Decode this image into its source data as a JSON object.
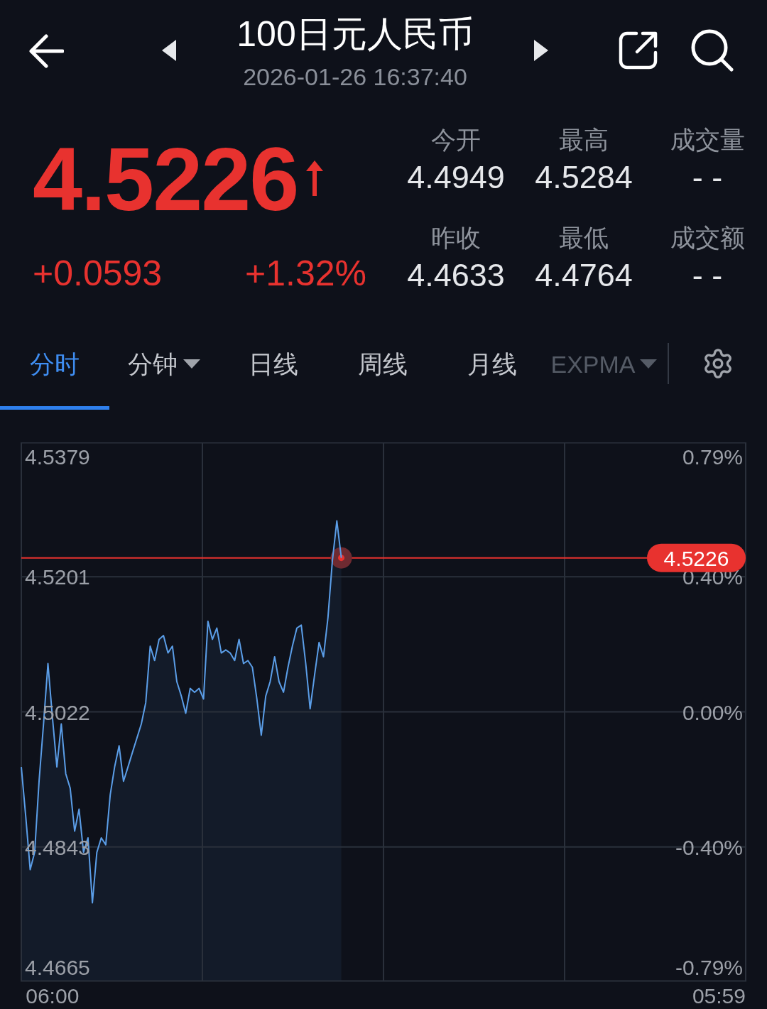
{
  "header": {
    "title": "100日元人民币",
    "timestamp": "2026-01-26 16:37:40"
  },
  "quote": {
    "price": "4.5226",
    "rising": true,
    "change": "+0.0593",
    "change_percent": "+1.32%"
  },
  "stats": [
    {
      "label": "今开",
      "value": "4.4949"
    },
    {
      "label": "最高",
      "value": "4.5284"
    },
    {
      "label": "成交量",
      "value": "- -"
    },
    {
      "label": "昨收",
      "value": "4.4633"
    },
    {
      "label": "最低",
      "value": "4.4764"
    },
    {
      "label": "成交额",
      "value": "- -"
    }
  ],
  "tabs": [
    {
      "label": "分时",
      "selected": true,
      "dropdown": false
    },
    {
      "label": "分钟",
      "selected": false,
      "dropdown": true
    },
    {
      "label": "日线",
      "selected": false,
      "dropdown": false
    },
    {
      "label": "周线",
      "selected": false,
      "dropdown": false
    },
    {
      "label": "月线",
      "selected": false,
      "dropdown": false
    }
  ],
  "indicator_selector": {
    "label": "EXPMA"
  },
  "chart": {
    "chart_data": {
      "type": "area",
      "grid": true,
      "categories": [
        null,
        null,
        null,
        null,
        null,
        null,
        null,
        "06:00",
        null,
        null,
        null,
        null,
        null,
        null,
        null,
        null,
        null,
        null,
        null,
        null,
        null,
        null,
        null,
        null,
        null,
        null,
        null,
        null,
        null,
        null,
        null,
        null,
        null,
        null,
        null,
        null,
        null,
        null,
        null,
        null,
        null,
        null,
        null,
        null,
        null,
        null,
        null,
        null,
        null,
        null,
        null,
        null,
        null,
        null,
        null,
        null,
        null,
        null,
        null,
        null,
        null,
        null,
        null,
        null,
        null,
        null,
        null,
        null,
        null,
        null,
        null,
        null,
        null,
        null,
        null,
        null,
        null,
        null,
        null,
        null,
        null,
        null,
        null,
        null,
        null,
        null,
        null,
        null,
        null,
        null,
        null,
        null,
        null,
        null,
        null,
        null,
        null,
        null,
        null,
        null,
        null,
        null,
        null,
        null,
        null,
        null,
        null,
        null,
        null,
        null,
        null,
        null,
        null,
        null,
        null,
        null,
        null,
        null,
        null,
        null,
        null,
        null,
        null,
        null,
        null,
        null,
        null,
        null,
        null,
        null,
        null,
        null,
        null,
        null,
        null,
        null,
        null,
        null,
        null,
        null,
        null,
        null,
        null,
        null,
        null,
        null,
        null,
        null,
        null,
        null,
        null,
        null,
        null,
        null,
        null,
        null,
        null,
        "05:59",
        null,
        null,
        null,
        null,
        null,
        null
      ],
      "series": [
        {
          "color": "#5b9ee8",
          "values": [
            4.4949,
            4.4883,
            4.4813,
            4.4836,
            4.493,
            4.5006,
            4.5086,
            4.5015,
            4.4949,
            4.5006,
            4.494,
            4.4921,
            4.4864,
            4.4893,
            4.4836,
            4.4855,
            4.4769,
            4.4836,
            4.4855,
            4.4846,
            4.4912,
            4.4949,
            4.4977,
            4.493,
            4.4949,
            4.4968,
            4.4987,
            4.5006,
            4.5034,
            4.5109,
            4.509,
            4.5118,
            4.5123,
            4.51,
            4.5109,
            4.5062,
            4.5043,
            4.502,
            4.5053,
            4.5048,
            4.5053,
            4.5039,
            4.5142,
            4.5118,
            4.5133,
            4.51,
            4.5104,
            4.51,
            4.509,
            4.5118,
            4.5086,
            4.509,
            4.5081,
            4.5039,
            4.4991,
            4.5043,
            4.5062,
            4.5095,
            4.5062,
            4.5048,
            4.5081,
            4.5109,
            4.5133,
            4.5137,
            4.5086,
            4.5026,
            4.5071,
            4.5114,
            4.5095,
            4.5147,
            4.5222,
            4.5275,
            4.5226,
            null,
            null,
            null,
            null,
            null,
            null,
            null,
            null,
            null,
            null,
            null,
            null,
            null,
            null,
            null,
            null,
            null,
            null,
            null,
            null,
            null,
            null,
            null,
            null,
            null,
            null,
            null,
            null,
            null,
            null,
            null,
            null,
            null,
            null,
            null,
            null,
            null,
            null,
            null,
            null,
            null,
            null,
            null,
            null,
            null,
            null,
            null,
            null,
            null,
            null,
            null,
            null,
            null,
            null,
            null,
            null,
            null,
            null,
            null,
            null,
            null,
            null,
            null,
            null,
            null,
            null,
            null,
            null,
            null,
            null,
            null,
            null,
            null,
            null,
            null,
            null,
            null,
            null,
            null,
            null,
            null,
            null,
            null,
            null,
            null,
            null,
            null,
            null,
            null,
            null,
            null
          ]
        }
      ],
      "ylim": [
        4.4665,
        4.5379
      ],
      "yticks": [
        4.5379,
        4.5201,
        4.5022,
        4.4843,
        4.4665
      ],
      "ref_lines": [
        {
          "axis": "y",
          "value": 4.5226,
          "label": "4.5226",
          "color": "#e8322f"
        }
      ]
    },
    "right_axis_labels": [
      "0.79%",
      "0.40%",
      "0.00%",
      "-0.40%",
      "-0.79%"
    ]
  }
}
